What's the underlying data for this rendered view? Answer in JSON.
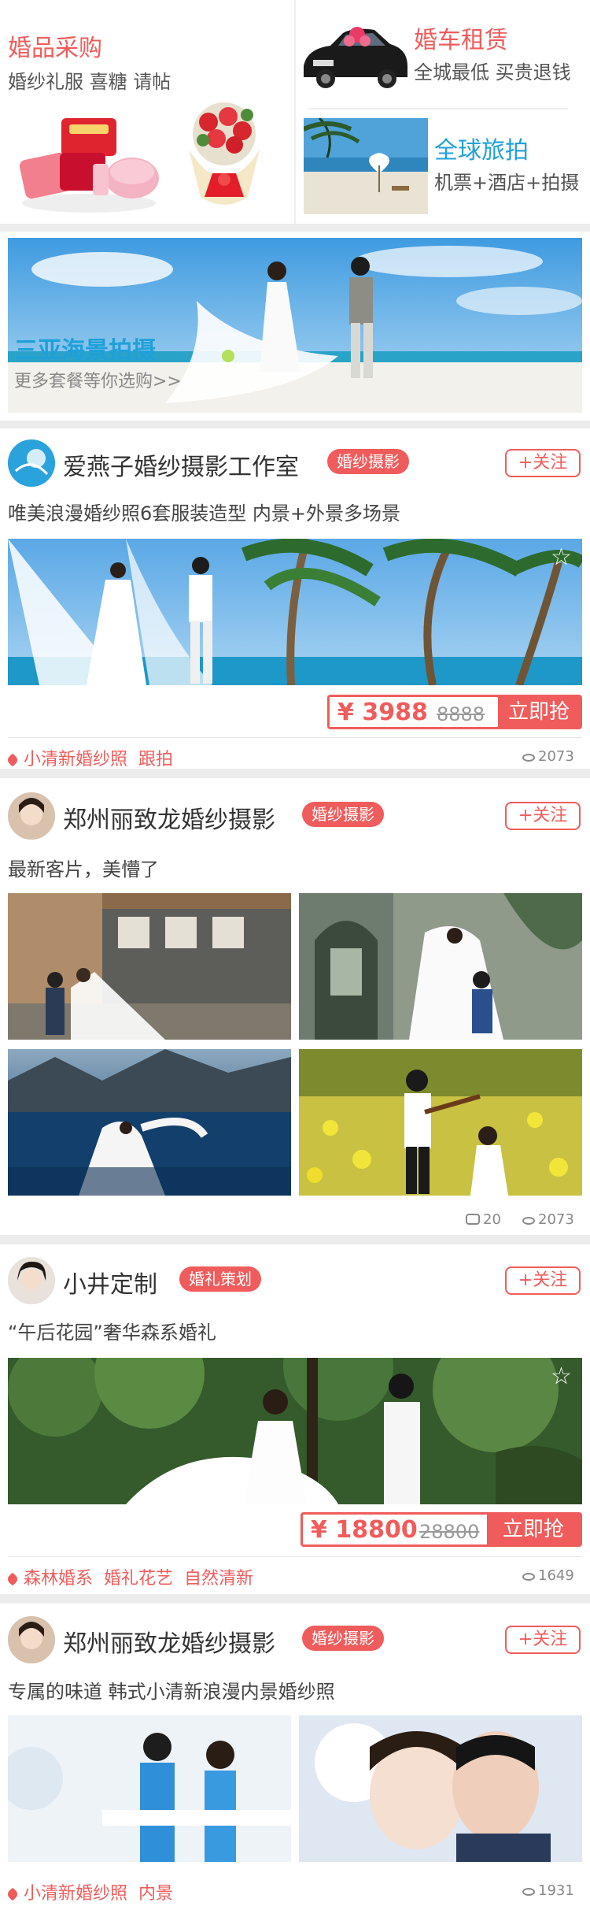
{
  "top": {
    "left": {
      "title": "婚品采购",
      "subtitle": "婚纱礼服 喜糖 请帖"
    },
    "right_top": {
      "title": "婚车租赁",
      "subtitle": "全城最低 买贵退钱"
    },
    "right_bottom": {
      "title": "全球旅拍",
      "subtitle": "机票+酒店+拍摄"
    }
  },
  "banner": {
    "title": "三亚海景拍摄",
    "subtitle": "更多套餐等你选购>>"
  },
  "posts": [
    {
      "studio": "爱燕子婚纱摄影工作室",
      "tag": "婚纱摄影",
      "follow": "+关注",
      "desc": "唯美浪漫婚纱照6套服装造型 内景+外景多场景",
      "price": "¥ 3988",
      "original": "8888",
      "buy": "立即抢",
      "tags": [
        "小清新婚纱照",
        "跟拍"
      ],
      "views": "2073"
    },
    {
      "studio": "郑州丽致龙婚纱摄影",
      "tag": "婚纱摄影",
      "follow": "+关注",
      "desc": "最新客片，美懵了",
      "comments": "20",
      "views": "2073"
    },
    {
      "studio": "小井定制",
      "tag": "婚礼策划",
      "follow": "+关注",
      "desc": "“午后花园”奢华森系婚礼",
      "price": "¥ 18800",
      "original": "28800",
      "buy": "立即抢",
      "tags": [
        "森林婚系",
        "婚礼花艺",
        "自然清新"
      ],
      "views": "1649"
    },
    {
      "studio": "郑州丽致龙婚纱摄影",
      "tag": "婚纱摄影",
      "follow": "+关注",
      "desc": "专属的味道 韩式小清新浪漫内景婚纱照",
      "tags": [
        "小清新婚纱照",
        "内景"
      ],
      "views": "1931"
    }
  ],
  "colors": {
    "accent": "#f05c5c",
    "link": "#1fa0d8"
  },
  "icons": [
    "star-icon",
    "eye-icon",
    "comment-icon",
    "tag-icon"
  ]
}
